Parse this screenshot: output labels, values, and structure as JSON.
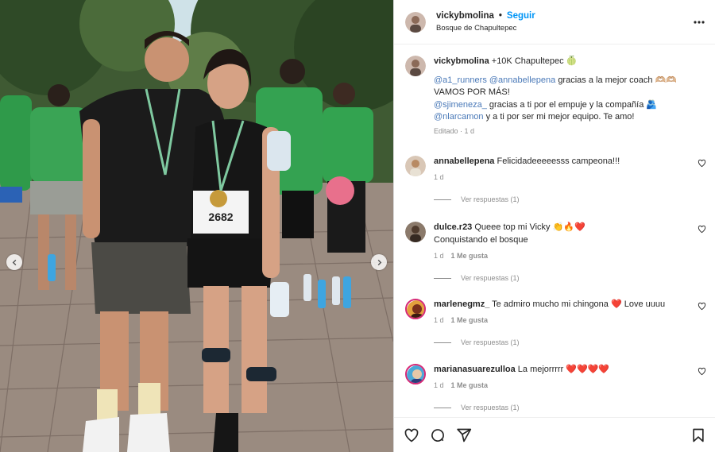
{
  "post": {
    "username": "vickybmolina",
    "separator": "•",
    "follow_label": "Seguir",
    "location": "Bosque de Chapultepec"
  },
  "caption": {
    "username": "vickybmolina",
    "line1_text": "+10K Chapultepec 🍈",
    "line2_m1": "@a1_runners",
    "line2_m2": "@annabellepena",
    "line2_text": "gracias a la mejor coach 🫶🏼🫶🏼",
    "line3_text": "VAMOS POR MÁS!",
    "line4_m": "@sjimeneza_",
    "line4_text": "gracias a ti por el empuje y la compañía 🫂",
    "line5_m": "@nlarcamon",
    "line5_text": "y a ti por ser mi mejor equipo. Te amo!",
    "meta": "Editado · 1 d"
  },
  "comments": [
    {
      "username": "annabellepena",
      "text": "Felicidadeeeeesss campeona!!!",
      "text2": "",
      "time": "1 d",
      "likes": "",
      "replies": "Ver respuestas (1)"
    },
    {
      "username": "dulce.r23",
      "text": "Queee top mi Vicky 👏🔥❤️",
      "text2": "Conquistando el bosque",
      "time": "1 d",
      "likes": "1 Me gusta",
      "replies": "Ver respuestas (1)"
    },
    {
      "username": "marlenegmz_",
      "text": "Te admiro mucho mi chingona ❤️ Love uuuu",
      "text2": "",
      "time": "1 d",
      "likes": "1 Me gusta",
      "replies": "Ver respuestas (1)"
    },
    {
      "username": "marianasuarezulloa",
      "text": "La mejorrrrr ❤️❤️❤️❤️",
      "text2": "",
      "time": "1 d",
      "likes": "1 Me gusta",
      "replies": "Ver respuestas (1)"
    }
  ],
  "photo": {
    "bib_number": "2682"
  },
  "icons": {
    "prev": "chevron-left-icon",
    "next": "chevron-right-icon",
    "more": "more-horizontal-icon",
    "like": "heart-icon",
    "comment": "comment-icon",
    "share": "send-icon",
    "save": "bookmark-icon"
  },
  "colors": {
    "accent": "#0095f6",
    "mention": "#4a79b8",
    "muted": "#8e8e8e",
    "shirt_green": "#2f9a4a"
  }
}
